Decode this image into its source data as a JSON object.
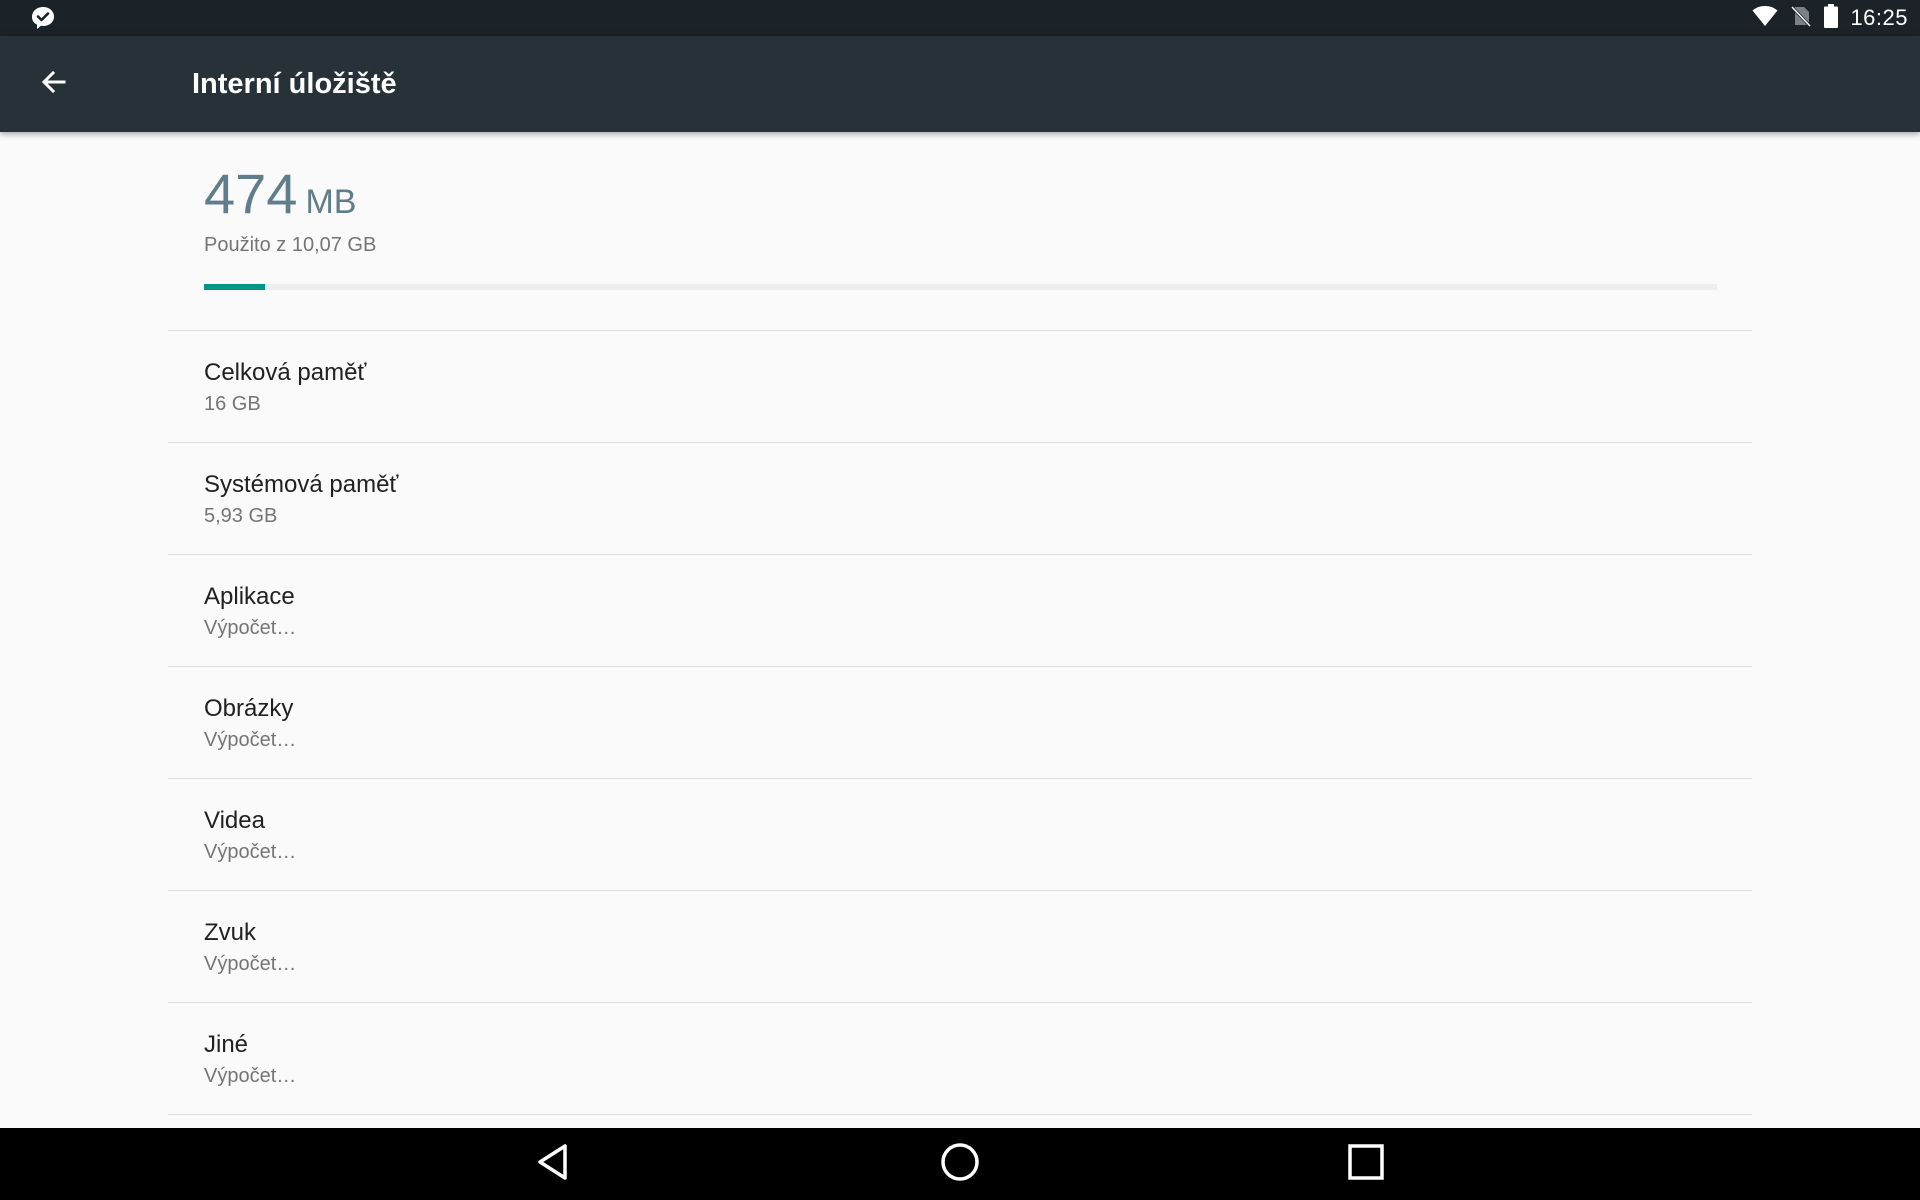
{
  "status_bar": {
    "time": "16:25",
    "icons": [
      "notification-icon",
      "wifi-icon",
      "no-sim-icon",
      "battery-icon"
    ]
  },
  "app_bar": {
    "title": "Interní úložiště",
    "back_icon": "arrow-back-icon"
  },
  "summary": {
    "used_value": "474",
    "used_unit": "MB",
    "used_of": "Použito z 10,07 GB",
    "progress_fraction": 0.04,
    "accent_color": "#009688"
  },
  "items": [
    {
      "title": "Celková paměť",
      "subtitle": "16 GB"
    },
    {
      "title": "Systémová paměť",
      "subtitle": "5,93 GB"
    },
    {
      "title": "Aplikace",
      "subtitle": "Výpočet…"
    },
    {
      "title": "Obrázky",
      "subtitle": "Výpočet…"
    },
    {
      "title": "Videa",
      "subtitle": "Výpočet…"
    },
    {
      "title": "Zvuk",
      "subtitle": "Výpočet…"
    },
    {
      "title": "Jiné",
      "subtitle": "Výpočet…"
    }
  ],
  "colors": {
    "status_bar_bg": "#1b2328",
    "app_bar_bg": "#263238",
    "summary_text": "#607d8b"
  },
  "nav_bar": {
    "buttons": [
      "back-triangle-icon",
      "home-circle-icon",
      "recents-square-icon"
    ]
  }
}
